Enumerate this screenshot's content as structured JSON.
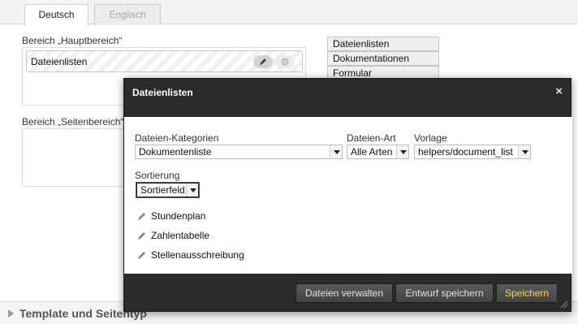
{
  "tabs": [
    {
      "label": "Deutsch",
      "active": true
    },
    {
      "label": "Englisch",
      "active": false
    }
  ],
  "areas": {
    "main_label": "Bereich „Hauptbereich“",
    "side_label": "Bereich „Seitenbereich“",
    "module_label": "Dateienlisten"
  },
  "palette": [
    "Dateienlisten",
    "Dokumentationen",
    "Formular"
  ],
  "bottom_section": {
    "title": "Template und Seitentyp"
  },
  "dialog": {
    "title": "Dateienlisten",
    "close_glyph": "×",
    "fields": {
      "categories": {
        "label": "Dateien-Kategorien",
        "value": "Dokumentenliste"
      },
      "type": {
        "label": "Dateien-Art",
        "value": "Alle Arten"
      },
      "template": {
        "label": "Vorlage",
        "value": "helpers/document_list"
      },
      "sorting": {
        "label": "Sortierung",
        "value": "Sortierfeld"
      }
    },
    "items": [
      "Stundenplan",
      "Zahlentabelle",
      "Stellenausschreibung"
    ],
    "buttons": {
      "manage": "Dateien verwalten",
      "draft": "Entwurf speichern",
      "save": "Speichern"
    }
  },
  "colors": {
    "dialog_bg": "#2b2b2b",
    "save_text": "#ffd74a"
  }
}
